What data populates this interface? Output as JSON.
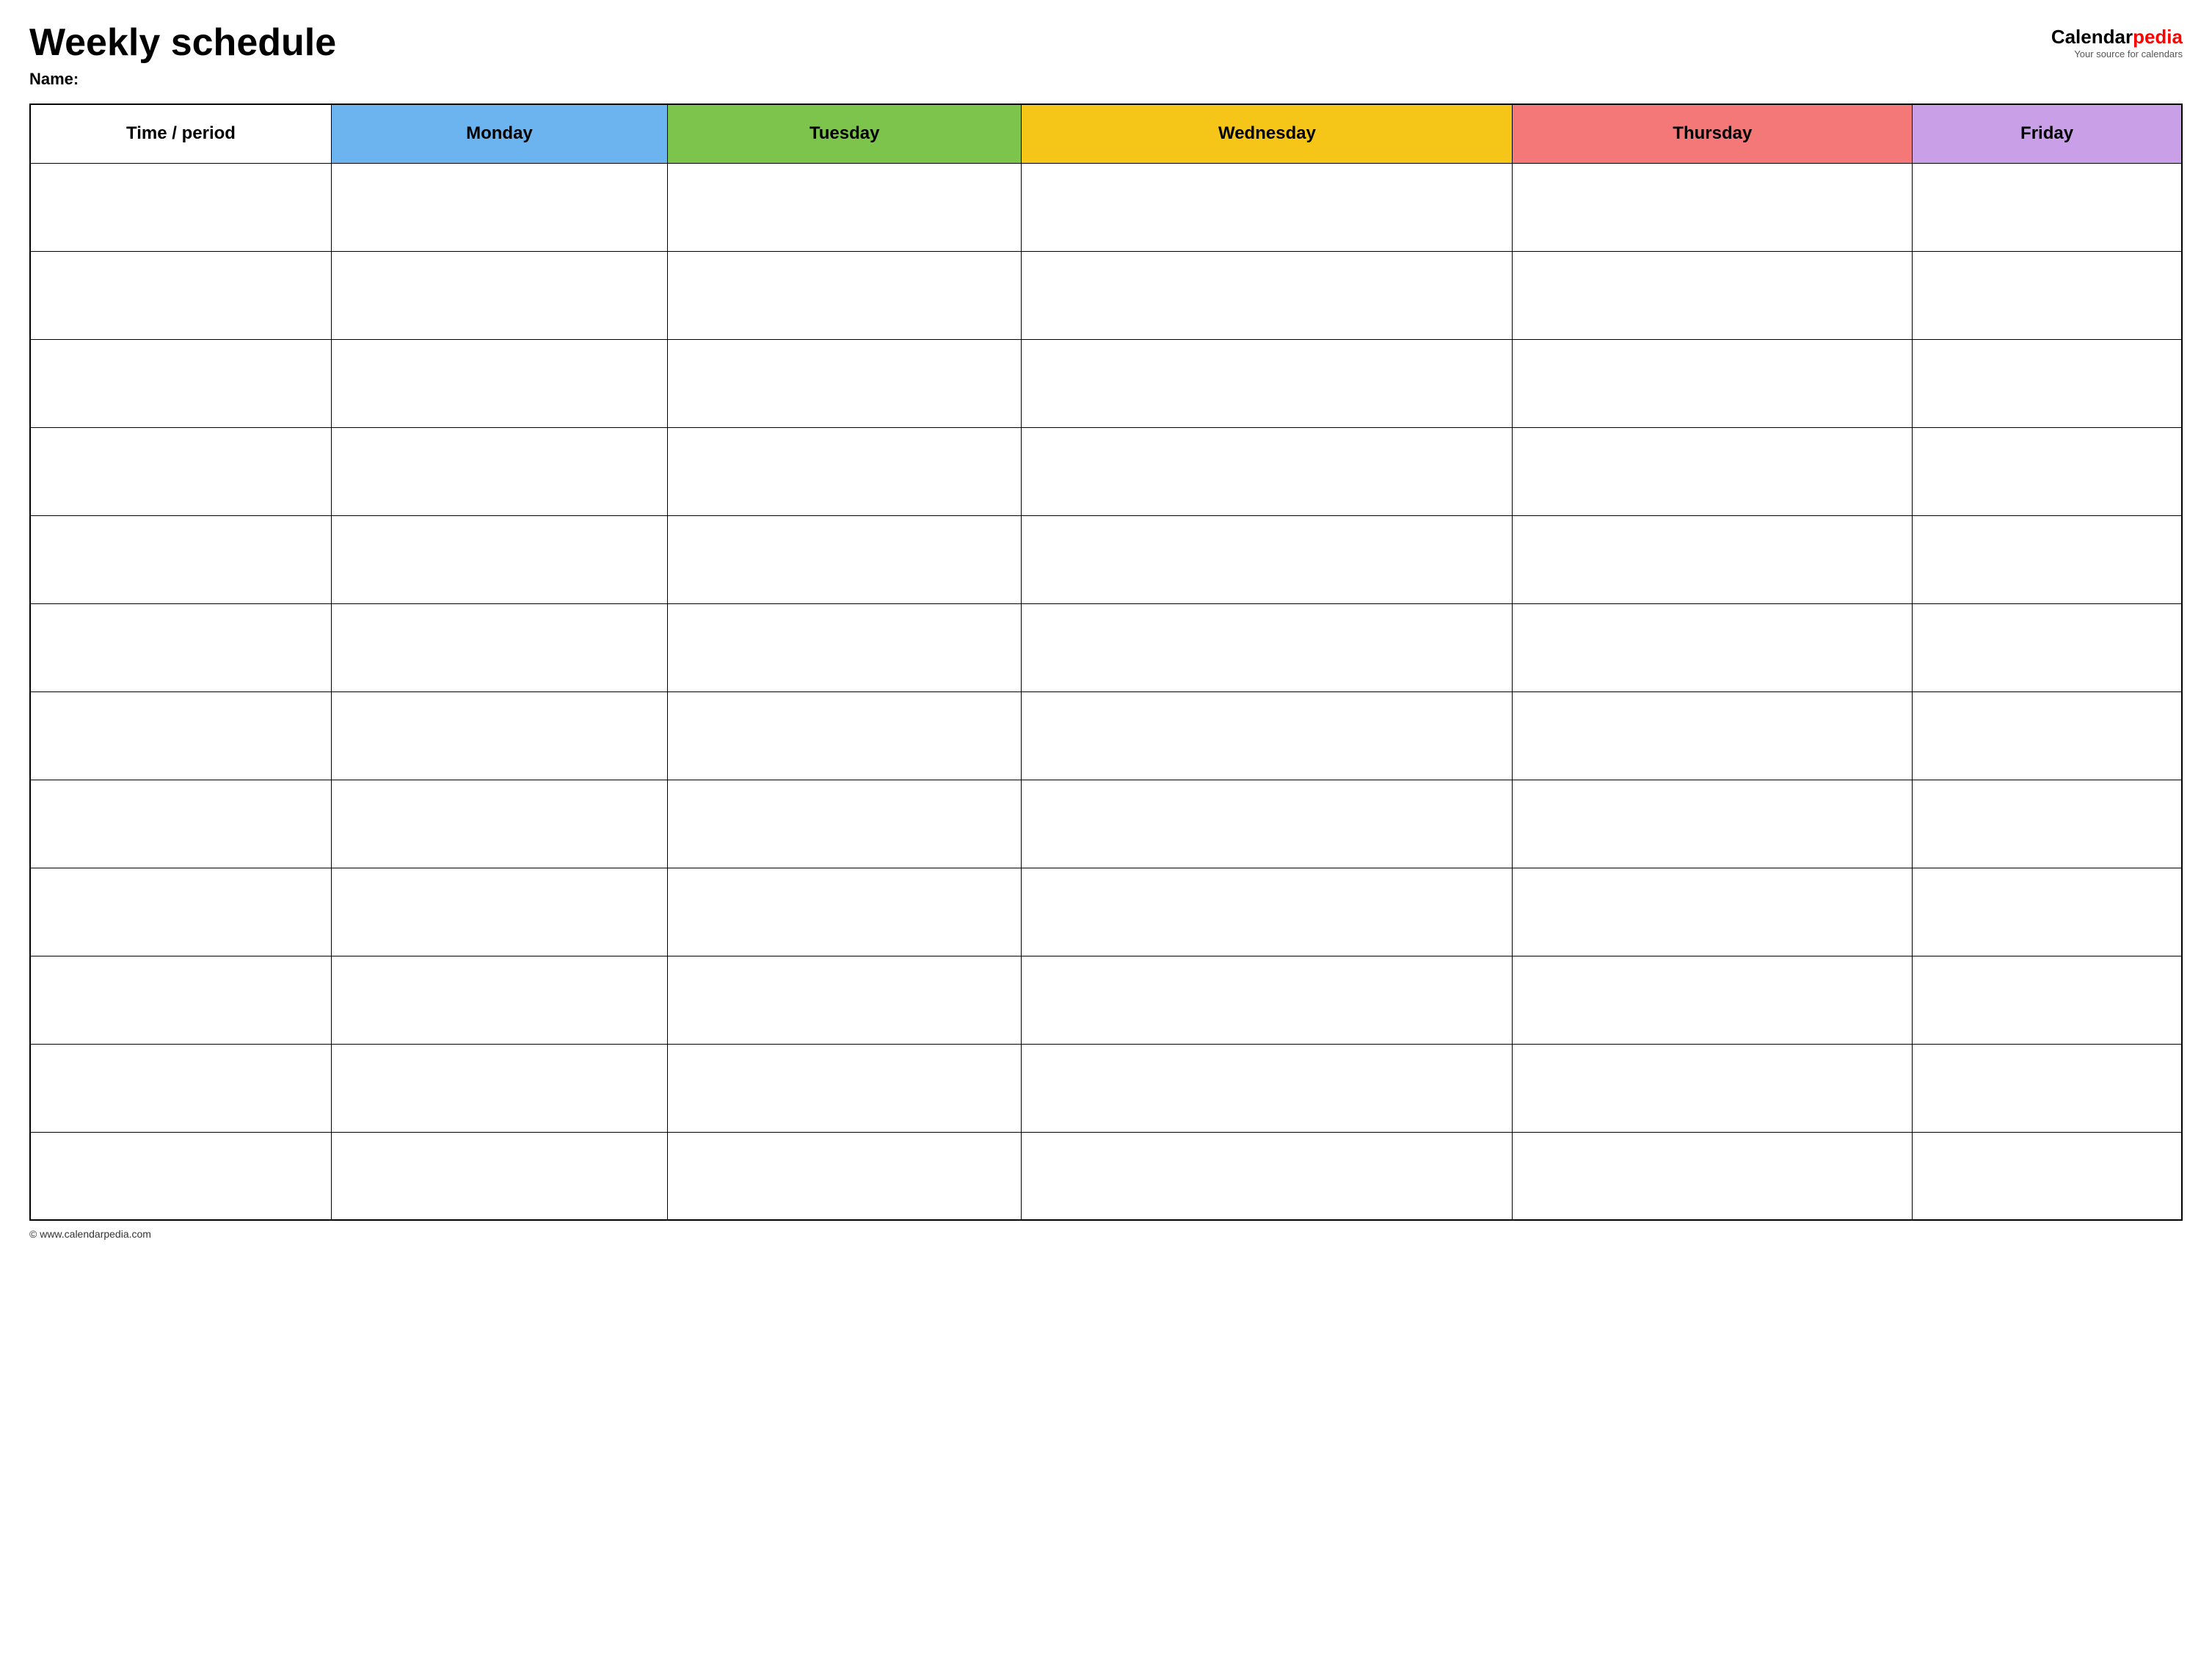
{
  "header": {
    "title": "Weekly schedule",
    "name_label": "Name:",
    "logo": {
      "calendar_text": "Calendar",
      "pedia_text": "pedia",
      "tagline": "Your source for calendars"
    }
  },
  "table": {
    "headers": [
      {
        "id": "time",
        "label": "Time / period",
        "color": "#ffffff",
        "class": "col-time"
      },
      {
        "id": "monday",
        "label": "Monday",
        "color": "#6cb4f0",
        "class": "col-monday"
      },
      {
        "id": "tuesday",
        "label": "Tuesday",
        "color": "#7cc44c",
        "class": "col-tuesday"
      },
      {
        "id": "wednesday",
        "label": "Wednesday",
        "color": "#f5c518",
        "class": "col-wednesday"
      },
      {
        "id": "thursday",
        "label": "Thursday",
        "color": "#f47878",
        "class": "col-thursday"
      },
      {
        "id": "friday",
        "label": "Friday",
        "color": "#c9a0e8",
        "class": "col-friday"
      }
    ],
    "row_count": 12
  },
  "footer": {
    "copyright": "© www.calendarpedia.com"
  }
}
